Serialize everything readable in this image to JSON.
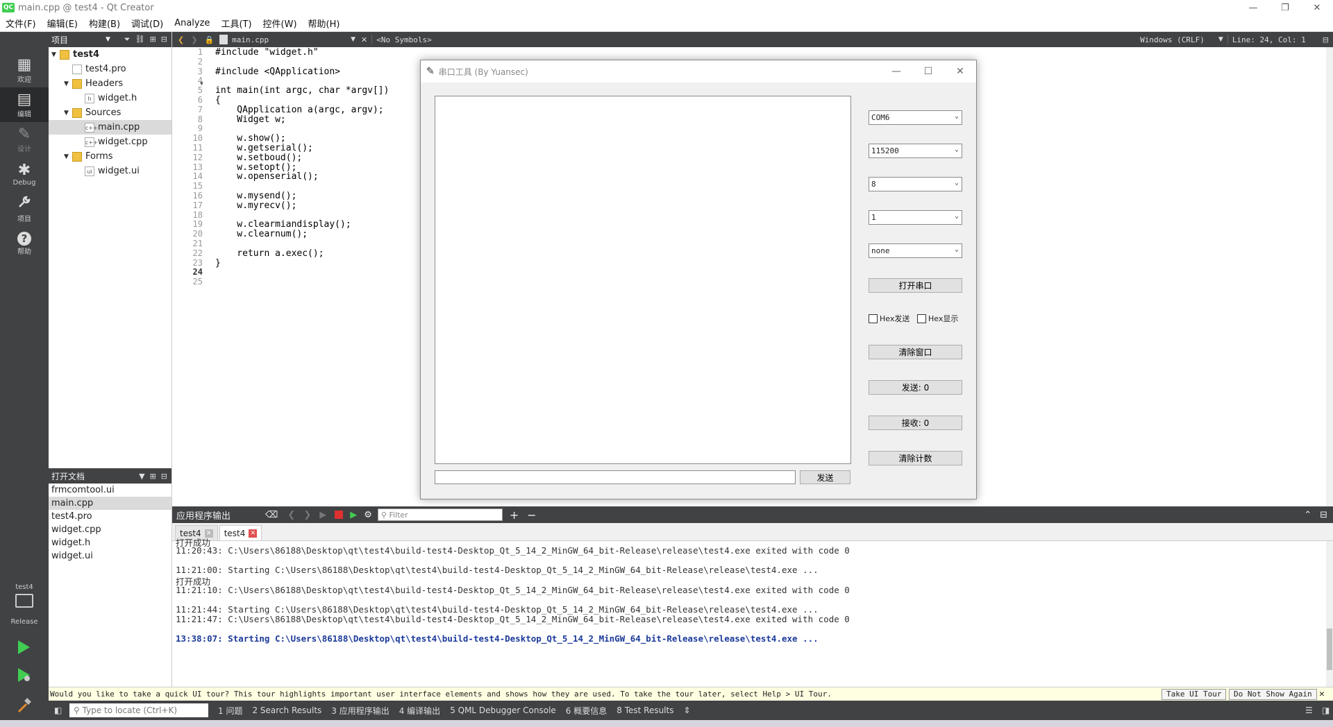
{
  "window": {
    "title": "main.cpp @ test4 - Qt Creator",
    "logo": "QC",
    "minimize": "—",
    "restore": "❐",
    "close": "✕"
  },
  "menu": [
    "文件(F)",
    "编辑(E)",
    "构建(B)",
    "调试(D)",
    "Analyze",
    "工具(T)",
    "控件(W)",
    "帮助(H)"
  ],
  "modes": [
    {
      "label": "欢迎",
      "icon": "grid-icon",
      "glyph": "▦"
    },
    {
      "label": "编辑",
      "icon": "edit-icon",
      "glyph": "▤"
    },
    {
      "label": "设计",
      "icon": "pen-icon",
      "glyph": "✎"
    },
    {
      "label": "Debug",
      "icon": "bug-icon",
      "glyph": "✱"
    },
    {
      "label": "项目",
      "icon": "wrench-icon",
      "glyph": "🔧"
    },
    {
      "label": "帮助",
      "icon": "help-icon",
      "glyph": "?"
    }
  ],
  "kit": {
    "project": "test4",
    "config": "Release"
  },
  "project_pane": {
    "title": "项目",
    "tree": [
      {
        "label": "test4",
        "depth": 0,
        "arrow": "▼",
        "icon": "folder",
        "bold": true
      },
      {
        "label": "test4.pro",
        "depth": 1,
        "arrow": "",
        "icon": "file"
      },
      {
        "label": "Headers",
        "depth": 1,
        "arrow": "▼",
        "icon": "folder"
      },
      {
        "label": "widget.h",
        "depth": 2,
        "arrow": "",
        "icon": "file",
        "tag": "h"
      },
      {
        "label": "Sources",
        "depth": 1,
        "arrow": "▼",
        "icon": "folder"
      },
      {
        "label": "main.cpp",
        "depth": 2,
        "arrow": "",
        "icon": "file",
        "tag": "c++",
        "selected": true
      },
      {
        "label": "widget.cpp",
        "depth": 2,
        "arrow": "",
        "icon": "file",
        "tag": "c++"
      },
      {
        "label": "Forms",
        "depth": 1,
        "arrow": "▼",
        "icon": "folder"
      },
      {
        "label": "widget.ui",
        "depth": 2,
        "arrow": "",
        "icon": "file",
        "tag": "ui"
      }
    ]
  },
  "open_docs": {
    "title": "打开文档",
    "items": [
      "frmcomtool.ui",
      "main.cpp",
      "test4.pro",
      "widget.cpp",
      "widget.h",
      "widget.ui"
    ],
    "selected": 1
  },
  "editor_toolbar": {
    "file": "main.cpp",
    "symbols": "<No Symbols>",
    "encoding": "Windows (CRLF)",
    "position": "Line: 24, Col: 1"
  },
  "code_lines": [
    "#include \"widget.h\"",
    "",
    "#include <QApplication>",
    "",
    "int main(int argc, char *argv[])",
    "{",
    "    QApplication a(argc, argv);",
    "    Widget w;",
    "",
    "    w.show();",
    "    w.getserial();",
    "    w.setboud();",
    "    w.setopt();",
    "    w.openserial();",
    "",
    "    w.mysend();",
    "    w.myrecv();",
    "",
    "    w.clearmiandisplay();",
    "    w.clearnum();",
    "",
    "    return a.exec();",
    "}",
    "",
    ""
  ],
  "output": {
    "title": "应用程序输出",
    "filter_placeholder": "Filter",
    "tabs": [
      "test4",
      "test4"
    ],
    "lines": [
      {
        "text": "打开成功",
        "cn": true
      },
      {
        "text": "11:20:43: C:\\Users\\86188\\Desktop\\qt\\test4\\build-test4-Desktop_Qt_5_14_2_MinGW_64_bit-Release\\release\\test4.exe exited with code 0"
      },
      {
        "text": ""
      },
      {
        "text": "11:21:00: Starting C:\\Users\\86188\\Desktop\\qt\\test4\\build-test4-Desktop_Qt_5_14_2_MinGW_64_bit-Release\\release\\test4.exe ..."
      },
      {
        "text": "打开成功",
        "cn": true
      },
      {
        "text": "11:21:10: C:\\Users\\86188\\Desktop\\qt\\test4\\build-test4-Desktop_Qt_5_14_2_MinGW_64_bit-Release\\release\\test4.exe exited with code 0"
      },
      {
        "text": ""
      },
      {
        "text": "11:21:44: Starting C:\\Users\\86188\\Desktop\\qt\\test4\\build-test4-Desktop_Qt_5_14_2_MinGW_64_bit-Release\\release\\test4.exe ..."
      },
      {
        "text": "11:21:47: C:\\Users\\86188\\Desktop\\qt\\test4\\build-test4-Desktop_Qt_5_14_2_MinGW_64_bit-Release\\release\\test4.exe exited with code 0"
      },
      {
        "text": ""
      },
      {
        "text": "13:38:07: Starting C:\\Users\\86188\\Desktop\\qt\\test4\\build-test4-Desktop_Qt_5_14_2_MinGW_64_bit-Release\\release\\test4.exe ...",
        "bold": true
      }
    ]
  },
  "tour": {
    "message": "Would you like to take a quick UI tour? This tour highlights important user interface elements and shows how they are used. To take the tour later, select Help > UI Tour.",
    "take": "Take UI Tour",
    "dismiss": "Do Not Show Again"
  },
  "status": {
    "locate_placeholder": "Type to locate (Ctrl+K)",
    "panes": [
      "1 问题",
      "2 Search Results",
      "3 应用程序输出",
      "4 编译输出",
      "5 QML Debugger Console",
      "6 概要信息",
      "8 Test Results"
    ]
  },
  "serial_tool": {
    "title": "串口工具 (By Yuansec)",
    "port": "COM6",
    "baud": "115200",
    "databits": "8",
    "stopbits": "1",
    "parity": "none",
    "open_btn": "打开串口",
    "hex_send": "Hex发送",
    "hex_show": "Hex显示",
    "clear_btn": "清除窗口",
    "sent": "发送: 0",
    "received": "接收: 0",
    "clear_count": "清除计数",
    "send_btn": "发送"
  },
  "colors": {
    "dark_panel": "#404244",
    "accent_green": "#41cd52"
  }
}
